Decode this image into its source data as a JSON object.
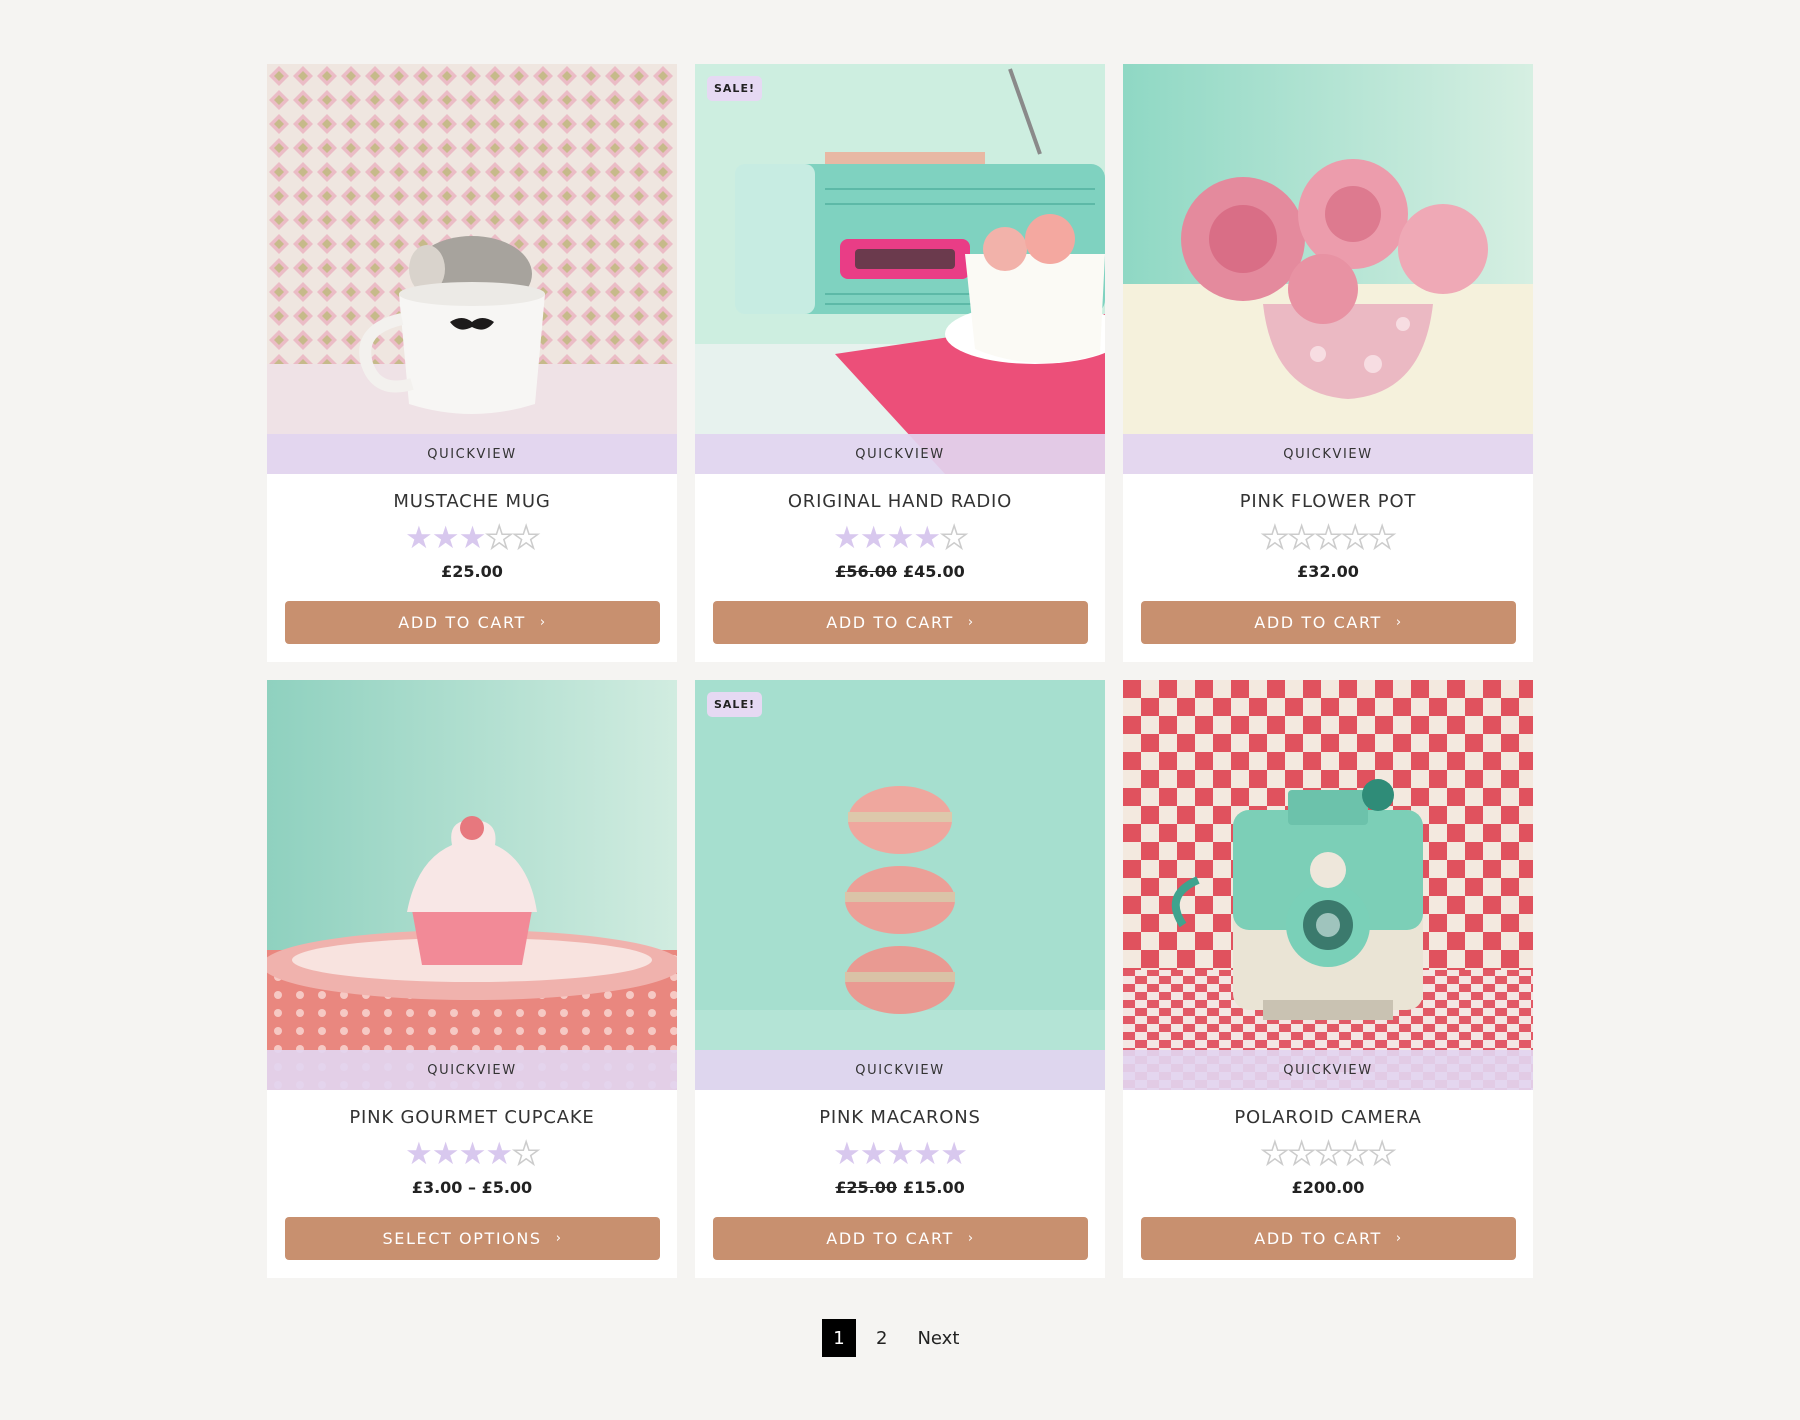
{
  "products": [
    {
      "title": "MUSTACHE MUG",
      "rating": 3,
      "sale": false,
      "price": "£25.00",
      "old_price": "",
      "button": "ADD TO CART",
      "quickview": "QUICKVIEW",
      "image_icon": "mustache-mug-image"
    },
    {
      "title": "ORIGINAL HAND RADIO",
      "rating": 4,
      "sale": true,
      "sale_label": "SALE!",
      "price": "£45.00",
      "old_price": "£56.00",
      "button": "ADD TO CART",
      "quickview": "QUICKVIEW",
      "image_icon": "radio-image"
    },
    {
      "title": "PINK FLOWER POT",
      "rating": 0,
      "sale": false,
      "price": "£32.00",
      "old_price": "",
      "button": "ADD TO CART",
      "quickview": "QUICKVIEW",
      "image_icon": "flower-pot-image"
    },
    {
      "title": "PINK GOURMET CUPCAKE",
      "rating": 4,
      "sale": false,
      "price": "£3.00 – £5.00",
      "old_price": "",
      "button": "SELECT OPTIONS",
      "quickview": "QUICKVIEW",
      "image_icon": "cupcake-image"
    },
    {
      "title": "PINK MACARONS",
      "rating": 5,
      "sale": true,
      "sale_label": "SALE!",
      "price": "£15.00",
      "old_price": "£25.00",
      "button": "ADD TO CART",
      "quickview": "QUICKVIEW",
      "image_icon": "macarons-image"
    },
    {
      "title": "POLAROID CAMERA",
      "rating": 0,
      "sale": false,
      "price": "£200.00",
      "old_price": "",
      "button": "ADD TO CART",
      "quickview": "QUICKVIEW",
      "image_icon": "camera-image"
    }
  ],
  "pagination": {
    "current": "1",
    "page2": "2",
    "next": "Next"
  },
  "colors": {
    "button": "#c8906f",
    "quickview": "#e2d5f0",
    "star": "#d8c8ee",
    "page_bg": "#f5f4f2"
  }
}
